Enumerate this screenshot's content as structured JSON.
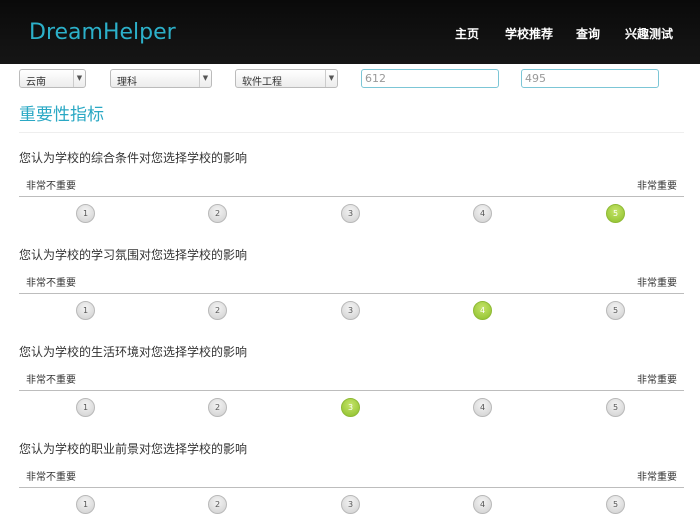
{
  "nav": {
    "brand": "DreamHelper",
    "items": [
      "主页",
      "学校推荐",
      "查询",
      "兴趣测试"
    ]
  },
  "filters": {
    "province": "云南",
    "subject": "理科",
    "major": "软件工程",
    "score_placeholder": "612",
    "rank_placeholder": "495"
  },
  "section_title": "重要性指标",
  "scale": {
    "low": "非常不重要",
    "high": "非常重要"
  },
  "options": [
    "1",
    "2",
    "3",
    "4",
    "5"
  ],
  "questions": [
    {
      "title": "您认为学校的综合条件对您选择学校的影响",
      "selected": 5
    },
    {
      "title": "您认为学校的学习氛围对您选择学校的影响",
      "selected": 4
    },
    {
      "title": "您认为学校的生活环境对您选择学校的影响",
      "selected": 3
    },
    {
      "title": "您认为学校的职业前景对您选择学校的影响",
      "selected": null
    }
  ],
  "colors": {
    "accent": "#2aa8c4",
    "selected": "#8cbf2a",
    "navbar": "#111111"
  }
}
